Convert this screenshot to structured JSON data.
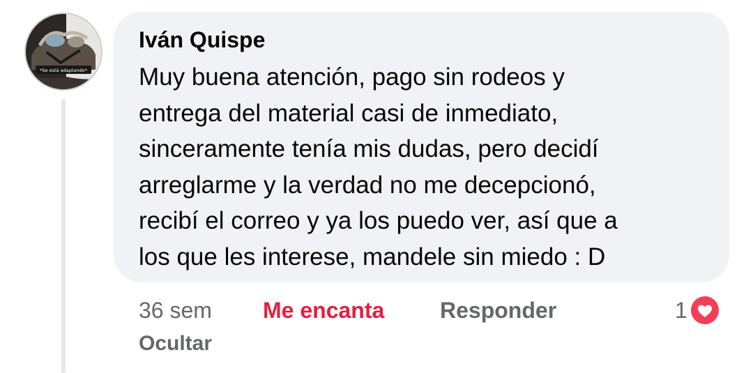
{
  "comment": {
    "author": "Iván Quispe",
    "text": "Muy buena atención, pago sin rodeos y\nentrega del material casi de inmediato,\nsinceramente tenía mis dudas, pero decidí\narreglarme y la verdad no me decepcionó,\nrecibí el correo y ya los puedo ver, así que a\nlos que les interese, mandele sin miedo : D",
    "avatar_caption": "*Se está adaptando*"
  },
  "actions": {
    "time": "36 sem",
    "love_label": "Me encanta",
    "reply_label": "Responder",
    "hide_label": "Ocultar"
  },
  "reactions": {
    "count": "1",
    "icon": "heart-icon"
  },
  "colors": {
    "bubble_bg": "#f0f2f5",
    "love_red": "#e41e3f",
    "muted_text": "#65676b",
    "text": "#050505",
    "heart_badge": "#f33e58"
  }
}
